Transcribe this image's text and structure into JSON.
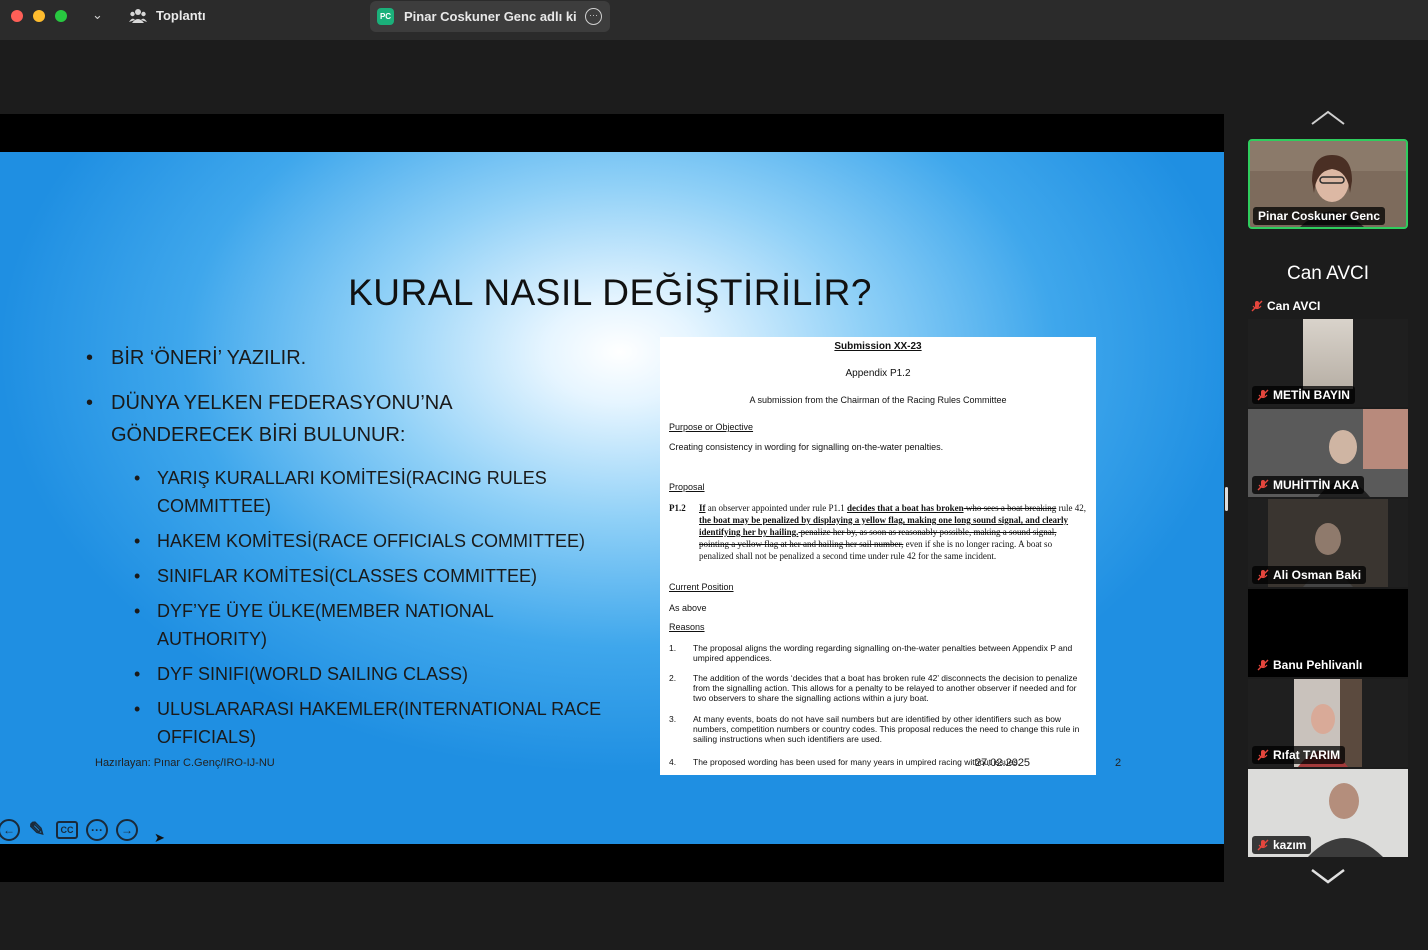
{
  "app": {
    "meeting_title": "Toplantı",
    "share_badge": "PC",
    "share_label": "Pinar Coskuner Genc adlı kişi ekranını paylaşıyor",
    "share_more_glyph": "···"
  },
  "slide": {
    "title": "KURAL NASIL DEĞİŞTİRİLİR?",
    "bullets": [
      "BİR ‘ÖNERİ’ YAZILIR.",
      "DÜNYA YELKEN FEDERASYONU’NA GÖNDERECEK BİRİ BULUNUR:"
    ],
    "sub_bullets": [
      "YARIŞ KURALLARI KOMİTESİ(RACING RULES COMMITTEE)",
      "HAKEM KOMİTESİ(RACE OFFICIALS COMMITTEE)",
      "SINIFLAR KOMİTESİ(CLASSES COMMITTEE)",
      "DYF’YE ÜYE ÜLKE(MEMBER NATIONAL AUTHORITY)",
      "DYF SINIFI(WORLD SAILING CLASS)",
      "ULUSLARARASI HAKEMLER(INTERNATIONAL RACE OFFICIALS)"
    ],
    "footer_left": "Hazırlayan: Pınar C.Genç/IRO-IJ-NU",
    "footer_date": "27.02.2025",
    "footer_page": "2"
  },
  "document": {
    "heading": "Submission XX-23",
    "subheading": "Appendix P1.2",
    "byline": "A submission from the Chairman of the Racing Rules Committee",
    "purpose_label": "Purpose or Objective",
    "purpose_text": "Creating consistency in wording for signalling on-the-water penalties.",
    "proposal_label": "Proposal",
    "proposal_rule": "P1.2",
    "proposal_if": "If",
    "proposal_a": " an observer appointed under rule P1.1 ",
    "proposal_b": "decides that a boat has broken",
    "proposal_c": " who sees a boat breaking",
    "proposal_d": " rule 42, ",
    "proposal_e": "the boat may be penalized by displaying a yellow flag, making one long sound signal, and clearly identifying her by hailing.",
    "proposal_f": " penalize her by, as soon as reasonably possible, making a sound signal, pointing a yellow flag at her and hailing her sail number,",
    "proposal_g": " even if she is no longer racing. A boat so penalized shall not be penalized a second time under rule 42 for the same incident.",
    "current_label": "Current Position",
    "current_text": "As above",
    "reasons_label": "Reasons",
    "reasons": [
      {
        "n": "1.",
        "text": "The proposal aligns the wording regarding signalling on-the-water penalties between Appendix P and umpired appendices."
      },
      {
        "n": "2.",
        "text": "The addition of the words ‘decides that a boat has broken rule 42’ disconnects the decision to penalize from the signalling action. This allows for a penalty to be relayed to another observer if needed and for two observers to share the signalling actions within a jury boat."
      },
      {
        "n": "3.",
        "text": "At many events, boats do not have sail numbers but are identified by other identifiers such as bow numbers, competition numbers or country codes. This proposal reduces the need to change this rule in sailing instructions when such identifiers are used."
      },
      {
        "n": "4.",
        "text": "The proposed wording has been used for many years in umpired racing without issues."
      }
    ]
  },
  "participants": {
    "active_speaker": "Pinar Coskuner Genc",
    "big_name": "Can AVCI",
    "tiles": [
      {
        "name": "Can AVCI"
      },
      {
        "name": "METİN BAYIN"
      },
      {
        "name": "MUHİTTİN AKA"
      },
      {
        "name": "Ali Osman Baki"
      },
      {
        "name": "Banu Pehlivanlı"
      },
      {
        "name": "Rıfat TARIM"
      },
      {
        "name": "kazım"
      }
    ]
  },
  "tools": {
    "cc_label": "CC",
    "more_glyph": "···"
  },
  "colors": {
    "active_border": "#2fcd5e",
    "muted_mic": "#e5463d"
  }
}
